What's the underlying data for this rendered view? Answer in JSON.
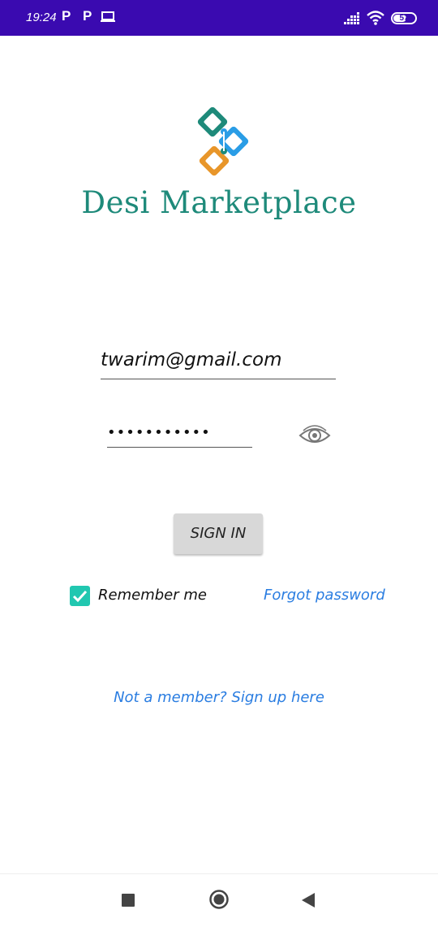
{
  "status_bar": {
    "time": "19:24",
    "notification_icons": [
      "P",
      "P"
    ],
    "battery_level": "57",
    "icons": [
      "laptop-icon",
      "signal-icon",
      "wifi-icon",
      "battery-icon"
    ]
  },
  "brand": {
    "name": "Desi Marketplace",
    "colors": {
      "teal": "#1e8a7a",
      "blue": "#2a9de6",
      "orange": "#e8962a"
    }
  },
  "login": {
    "email_value": "twarim@gmail.com",
    "password_masked": "•••••••••••",
    "sign_in_label": "SIGN IN",
    "remember_label": "Remember me",
    "remember_checked": true,
    "forgot_label": "Forgot password",
    "signup_label": "Not a member? Sign up here"
  },
  "colors": {
    "status_bar": "#3a0ab0",
    "link": "#2a7de1",
    "checkbox": "#21c7b0",
    "button_bg": "#d8d8d8"
  },
  "navigation_bar": {
    "icons": [
      "recent-apps-icon",
      "home-icon",
      "back-icon"
    ]
  }
}
